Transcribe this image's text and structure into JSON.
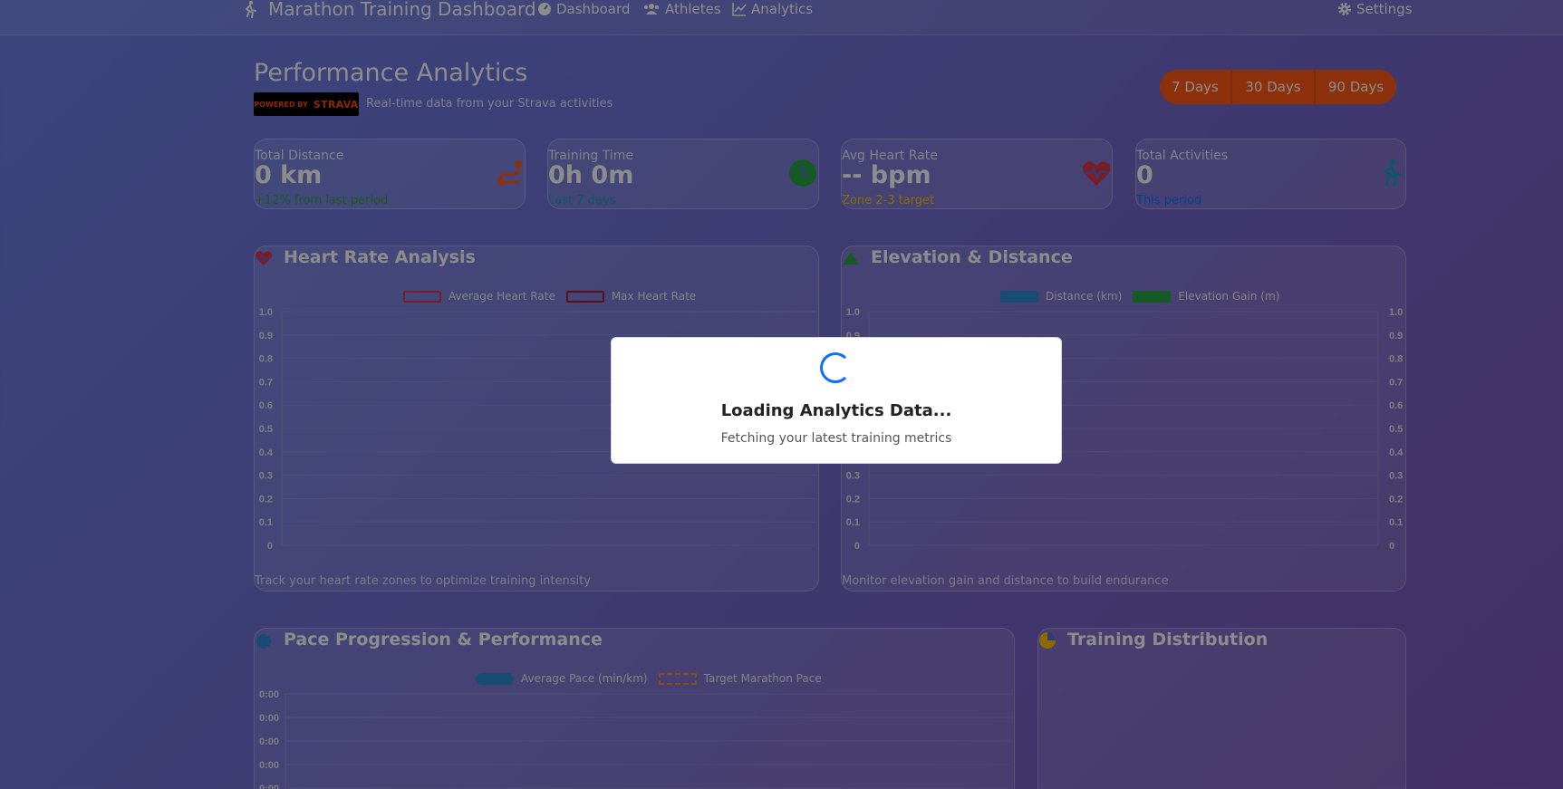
{
  "nav": {
    "brand": "Marathon Training Dashboard",
    "links": [
      "Dashboard",
      "Athletes",
      "Analytics"
    ],
    "settings": "Settings"
  },
  "header": {
    "title": "Performance Analytics",
    "badge_powered": "POWERED BY",
    "badge_brand": "STRAVA",
    "subtitle": "Real-time data from your Strava activities"
  },
  "periods": [
    "7 Days",
    "30 Days",
    "90 Days"
  ],
  "stats": [
    {
      "label": "Total Distance",
      "value": "0 km",
      "sub": "+12% from last period",
      "sub_color": "#28a745",
      "icon": "route-icon",
      "icon_color": "#ff5a14"
    },
    {
      "label": "Training Time",
      "value": "0h 0m",
      "sub": "Last 7 days",
      "sub_color": "#17a2b8",
      "icon": "clock-icon",
      "icon_color": "#28a745"
    },
    {
      "label": "Avg Heart Rate",
      "value": "-- bpm",
      "sub": "Zone 2-3 target",
      "sub_color": "#ffc107",
      "icon": "heartbeat-icon",
      "icon_color": "#dc3545"
    },
    {
      "label": "Total Activities",
      "value": "0",
      "sub": "This period",
      "sub_color": "#007bff",
      "icon": "runner-icon",
      "icon_color": "#17a2b8"
    }
  ],
  "heart_panel": {
    "title": "Heart Rate Analysis",
    "legend": [
      "Average Heart Rate",
      "Max Heart Rate"
    ],
    "footer": "Track your heart rate zones to optimize training intensity"
  },
  "elev_panel": {
    "title": "Elevation & Distance",
    "legend": [
      "Distance (km)",
      "Elevation Gain (m)"
    ],
    "footer": "Monitor elevation gain and distance to build endurance"
  },
  "pace_panel": {
    "title": "Pace Progression & Performance",
    "legend": [
      "Average Pace (min/km)",
      "Target Marathon Pace"
    ]
  },
  "dist_panel": {
    "title": "Training Distribution"
  },
  "loading": {
    "title": "Loading Analytics Data...",
    "text": "Fetching your latest training metrics"
  },
  "chart_data": [
    {
      "type": "line",
      "title": "Heart Rate Analysis",
      "series": [
        {
          "name": "Average Heart Rate",
          "values": []
        },
        {
          "name": "Max Heart Rate",
          "values": []
        }
      ],
      "ylim": [
        0,
        1.0
      ],
      "yticks": [
        "1.0",
        "0.9",
        "0.8",
        "0.7",
        "0.6",
        "0.5",
        "0.4",
        "0.3",
        "0.2",
        "0.1",
        "0"
      ]
    },
    {
      "type": "bar",
      "title": "Elevation & Distance",
      "series": [
        {
          "name": "Distance (km)",
          "values": []
        },
        {
          "name": "Elevation Gain (m)",
          "values": []
        }
      ],
      "ylim": [
        0,
        1.0
      ],
      "yticks": [
        "1.0",
        "0.9",
        "0.8",
        "0.7",
        "0.6",
        "0.5",
        "0.4",
        "0.3",
        "0.2",
        "0.1",
        "0"
      ]
    },
    {
      "type": "line",
      "title": "Pace Progression & Performance",
      "series": [
        {
          "name": "Average Pace (min/km)",
          "values": []
        },
        {
          "name": "Target Marathon Pace",
          "values": []
        }
      ],
      "yticks": [
        "0:00",
        "0:00",
        "0:00",
        "0:00",
        "0:00"
      ]
    }
  ]
}
